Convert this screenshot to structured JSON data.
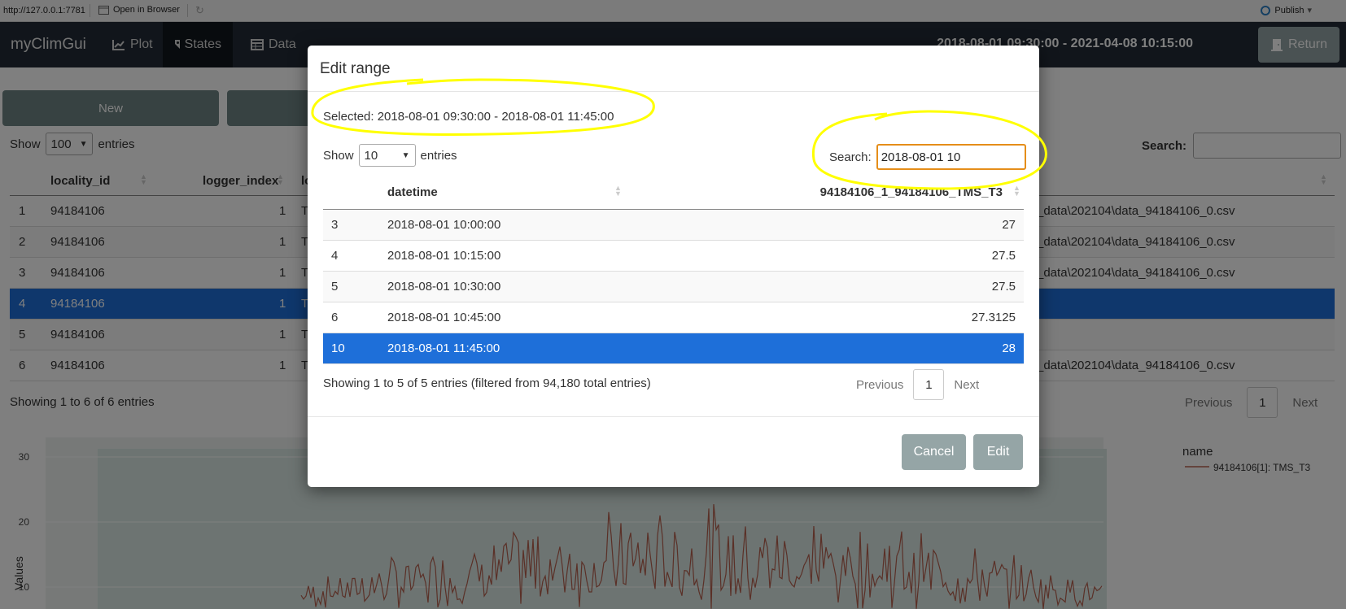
{
  "browser": {
    "url": "http://127.0.0.1:7781",
    "open_in_browser": "Open in Browser",
    "publish": "Publish"
  },
  "navbar": {
    "brand": "myClimGui",
    "tabs": [
      {
        "label": "Plot",
        "icon": "chart-line-icon"
      },
      {
        "label": "States",
        "icon": "tags-icon"
      },
      {
        "label": "Data",
        "icon": "table-icon"
      }
    ],
    "range": "2018-08-01 09:30:00 - 2021-04-08 10:15:00",
    "return_label": "Return"
  },
  "background": {
    "new_button": "New",
    "show_label": "Show",
    "show_value": "100",
    "entries_label": "entries",
    "search_label": "Search:",
    "headers": {
      "col1": "locality_id",
      "col2": "logger_index",
      "col3": "lo"
    },
    "rows": [
      {
        "n": "1",
        "locality": "94184106",
        "logger": "1",
        "t": "T",
        "file": "_data\\202104\\data_94184106_0.csv"
      },
      {
        "n": "2",
        "locality": "94184106",
        "logger": "1",
        "t": "T",
        "file": "_data\\202104\\data_94184106_0.csv"
      },
      {
        "n": "3",
        "locality": "94184106",
        "logger": "1",
        "t": "T",
        "file": "_data\\202104\\data_94184106_0.csv"
      },
      {
        "n": "4",
        "locality": "94184106",
        "logger": "1",
        "t": "T",
        "file": ""
      },
      {
        "n": "5",
        "locality": "94184106",
        "logger": "1",
        "t": "T",
        "file": ""
      },
      {
        "n": "6",
        "locality": "94184106",
        "logger": "1",
        "t": "T",
        "file": "_data\\202104\\data_94184106_0.csv"
      }
    ],
    "info": "Showing 1 to 6 of 6 entries",
    "pager": {
      "previous": "Previous",
      "page": "1",
      "next": "Next"
    }
  },
  "plot": {
    "ylabel": "Values",
    "yticks": [
      "30",
      "20",
      "10"
    ],
    "legend_title": "name",
    "legend_item": "94184106[1]: TMS_T3",
    "colors": {
      "band": "#dbe9e4",
      "line": "#b5604f"
    }
  },
  "modal": {
    "title": "Edit range",
    "selected": "Selected: 2018-08-01 09:30:00 - 2018-08-01 11:45:00",
    "show_label": "Show",
    "show_value": "10",
    "entries_label": "entries",
    "search_label": "Search:",
    "search_value": "2018-08-01 10",
    "col_datetime": "datetime",
    "col_value": "94184106_1_94184106_TMS_T3",
    "rows": [
      {
        "idx": "3",
        "datetime": "2018-08-01 10:00:00",
        "value": "27"
      },
      {
        "idx": "4",
        "datetime": "2018-08-01 10:15:00",
        "value": "27.5"
      },
      {
        "idx": "5",
        "datetime": "2018-08-01 10:30:00",
        "value": "27.5"
      },
      {
        "idx": "6",
        "datetime": "2018-08-01 10:45:00",
        "value": "27.3125"
      },
      {
        "idx": "10",
        "datetime": "2018-08-01 11:45:00",
        "value": "28"
      }
    ],
    "info": "Showing 1 to 5 of 5 entries (filtered from 94,180 total entries)",
    "pager": {
      "previous": "Previous",
      "page": "1",
      "next": "Next"
    },
    "cancel": "Cancel",
    "edit": "Edit"
  },
  "colors": {
    "accent": "#1e6fd9",
    "navbar": "#222b36",
    "button": "#95a5a6",
    "highlight": "#ffff00",
    "focus": "#e58e1a"
  }
}
